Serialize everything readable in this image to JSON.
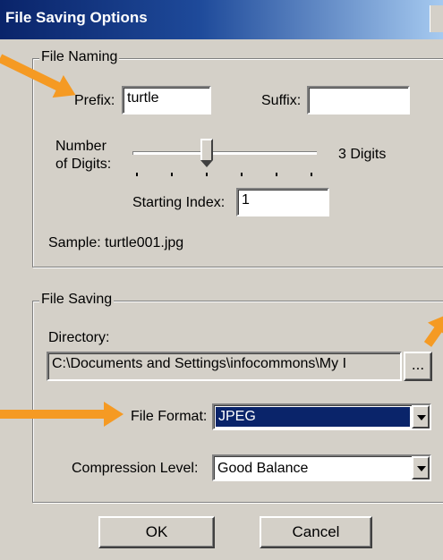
{
  "window": {
    "title": "File Saving Options"
  },
  "file_naming": {
    "legend": "File Naming",
    "prefix_label": "Prefix:",
    "prefix_value": "turtle",
    "suffix_label": "Suffix:",
    "suffix_value": "",
    "digits_label_line1": "Number",
    "digits_label_line2": "of Digits:",
    "digits_value_text": "3 Digits",
    "digits_slider_level": 3,
    "starting_index_label": "Starting Index:",
    "starting_index_value": "1",
    "sample_text": "Sample: turtle001.jpg"
  },
  "file_saving": {
    "legend": "File Saving",
    "directory_label": "Directory:",
    "directory_value": "C:\\Documents and Settings\\infocommons\\My I",
    "browse_label": "...",
    "format_label": "File Format:",
    "format_value": "JPEG",
    "compression_label": "Compression Level:",
    "compression_value": "Good Balance"
  },
  "buttons": {
    "ok": "OK",
    "cancel": "Cancel"
  },
  "colors": {
    "highlight": "#0a246a",
    "annotation_arrow": "#f59a23",
    "dialog_bg": "#d4d0c8"
  }
}
